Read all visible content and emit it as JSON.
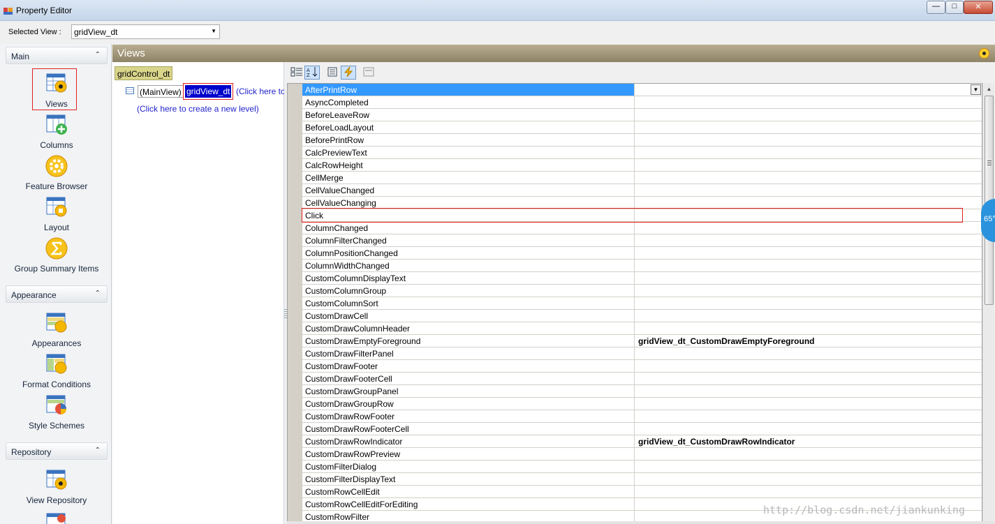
{
  "window": {
    "title": "Property Editor"
  },
  "selected_view": {
    "label": "Selected View :",
    "value": "gridView_dt"
  },
  "nav": {
    "groups": [
      {
        "label": "Main",
        "items": [
          "Views",
          "Columns",
          "Feature Browser",
          "Layout",
          "Group Summary Items"
        ]
      },
      {
        "label": "Appearance",
        "items": [
          "Appearances",
          "Format Conditions",
          "Style Schemes"
        ]
      },
      {
        "label": "Repository",
        "items": [
          "View Repository"
        ]
      }
    ]
  },
  "views_panel": {
    "title": "Views"
  },
  "tree": {
    "grid_control": "gridControl_dt",
    "main_view": "(MainView)",
    "selected_view": "gridView_dt",
    "click_here_inline": "(Click here to",
    "create_level": "(Click here to create a new level)"
  },
  "properties": {
    "rows": [
      {
        "name": "AfterPrintRow",
        "value": ""
      },
      {
        "name": "AsyncCompleted",
        "value": ""
      },
      {
        "name": "BeforeLeaveRow",
        "value": ""
      },
      {
        "name": "BeforeLoadLayout",
        "value": ""
      },
      {
        "name": "BeforePrintRow",
        "value": ""
      },
      {
        "name": "CalcPreviewText",
        "value": ""
      },
      {
        "name": "CalcRowHeight",
        "value": ""
      },
      {
        "name": "CellMerge",
        "value": ""
      },
      {
        "name": "CellValueChanged",
        "value": ""
      },
      {
        "name": "CellValueChanging",
        "value": ""
      },
      {
        "name": "Click",
        "value": ""
      },
      {
        "name": "ColumnChanged",
        "value": ""
      },
      {
        "name": "ColumnFilterChanged",
        "value": ""
      },
      {
        "name": "ColumnPositionChanged",
        "value": ""
      },
      {
        "name": "ColumnWidthChanged",
        "value": ""
      },
      {
        "name": "CustomColumnDisplayText",
        "value": ""
      },
      {
        "name": "CustomColumnGroup",
        "value": ""
      },
      {
        "name": "CustomColumnSort",
        "value": ""
      },
      {
        "name": "CustomDrawCell",
        "value": ""
      },
      {
        "name": "CustomDrawColumnHeader",
        "value": ""
      },
      {
        "name": "CustomDrawEmptyForeground",
        "value": "gridView_dt_CustomDrawEmptyForeground"
      },
      {
        "name": "CustomDrawFilterPanel",
        "value": ""
      },
      {
        "name": "CustomDrawFooter",
        "value": ""
      },
      {
        "name": "CustomDrawFooterCell",
        "value": ""
      },
      {
        "name": "CustomDrawGroupPanel",
        "value": ""
      },
      {
        "name": "CustomDrawGroupRow",
        "value": ""
      },
      {
        "name": "CustomDrawRowFooter",
        "value": ""
      },
      {
        "name": "CustomDrawRowFooterCell",
        "value": ""
      },
      {
        "name": "CustomDrawRowIndicator",
        "value": "gridView_dt_CustomDrawRowIndicator"
      },
      {
        "name": "CustomDrawRowPreview",
        "value": ""
      },
      {
        "name": "CustomFilterDialog",
        "value": ""
      },
      {
        "name": "CustomFilterDisplayText",
        "value": ""
      },
      {
        "name": "CustomRowCellEdit",
        "value": ""
      },
      {
        "name": "CustomRowCellEditForEditing",
        "value": ""
      },
      {
        "name": "CustomRowFilter",
        "value": ""
      }
    ]
  },
  "overlay": {
    "badge": "65°",
    "watermark": "http://blog.csdn.net/jiankunking"
  },
  "colors": {
    "selection": "#3399ff",
    "highlight_frame": "#e02020",
    "views_header": "#a89d80"
  }
}
